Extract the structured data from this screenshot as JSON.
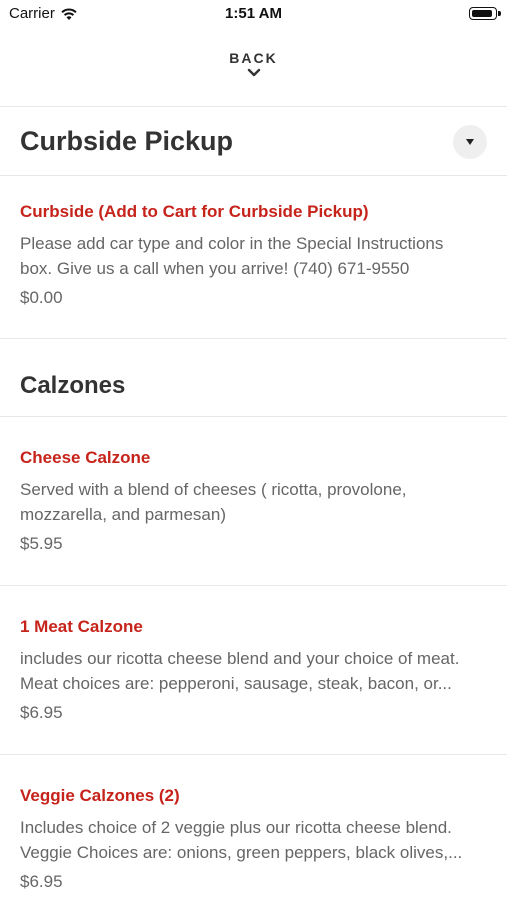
{
  "status_bar": {
    "carrier": "Carrier",
    "time": "1:51 AM"
  },
  "header": {
    "back_label": "BACK"
  },
  "sections": [
    {
      "title": "Curbside Pickup",
      "items": [
        {
          "name": "Curbside (Add to Cart for Curbside Pickup)",
          "desc_line1": "Please add car type and color in the Special Instructions",
          "desc_line2": "box. Give us a call when you arrive! (740) 671-9550",
          "price": "$0.00"
        }
      ]
    },
    {
      "title": "Calzones",
      "items": [
        {
          "name": "Cheese Calzone",
          "desc_line1": "Served with a blend of cheeses ( ricotta, provolone,",
          "desc_line2": "mozzarella, and parmesan)",
          "price": "$5.95"
        },
        {
          "name": "1 Meat Calzone",
          "desc_line1": "includes our ricotta cheese blend and your choice of meat.",
          "desc_line2": "Meat choices are: pepperoni, sausage, steak, bacon, or...",
          "price": "$6.95"
        },
        {
          "name": "Veggie Calzones (2)",
          "desc_line1": "Includes choice of 2 veggie plus our ricotta cheese blend.",
          "desc_line2": "Veggie Choices are: onions, green peppers, black olives,...",
          "price": "$6.95"
        }
      ]
    }
  ],
  "colors": {
    "item_name": "#c6231b",
    "text_muted": "#666666",
    "divider": "#e8e8e8"
  }
}
